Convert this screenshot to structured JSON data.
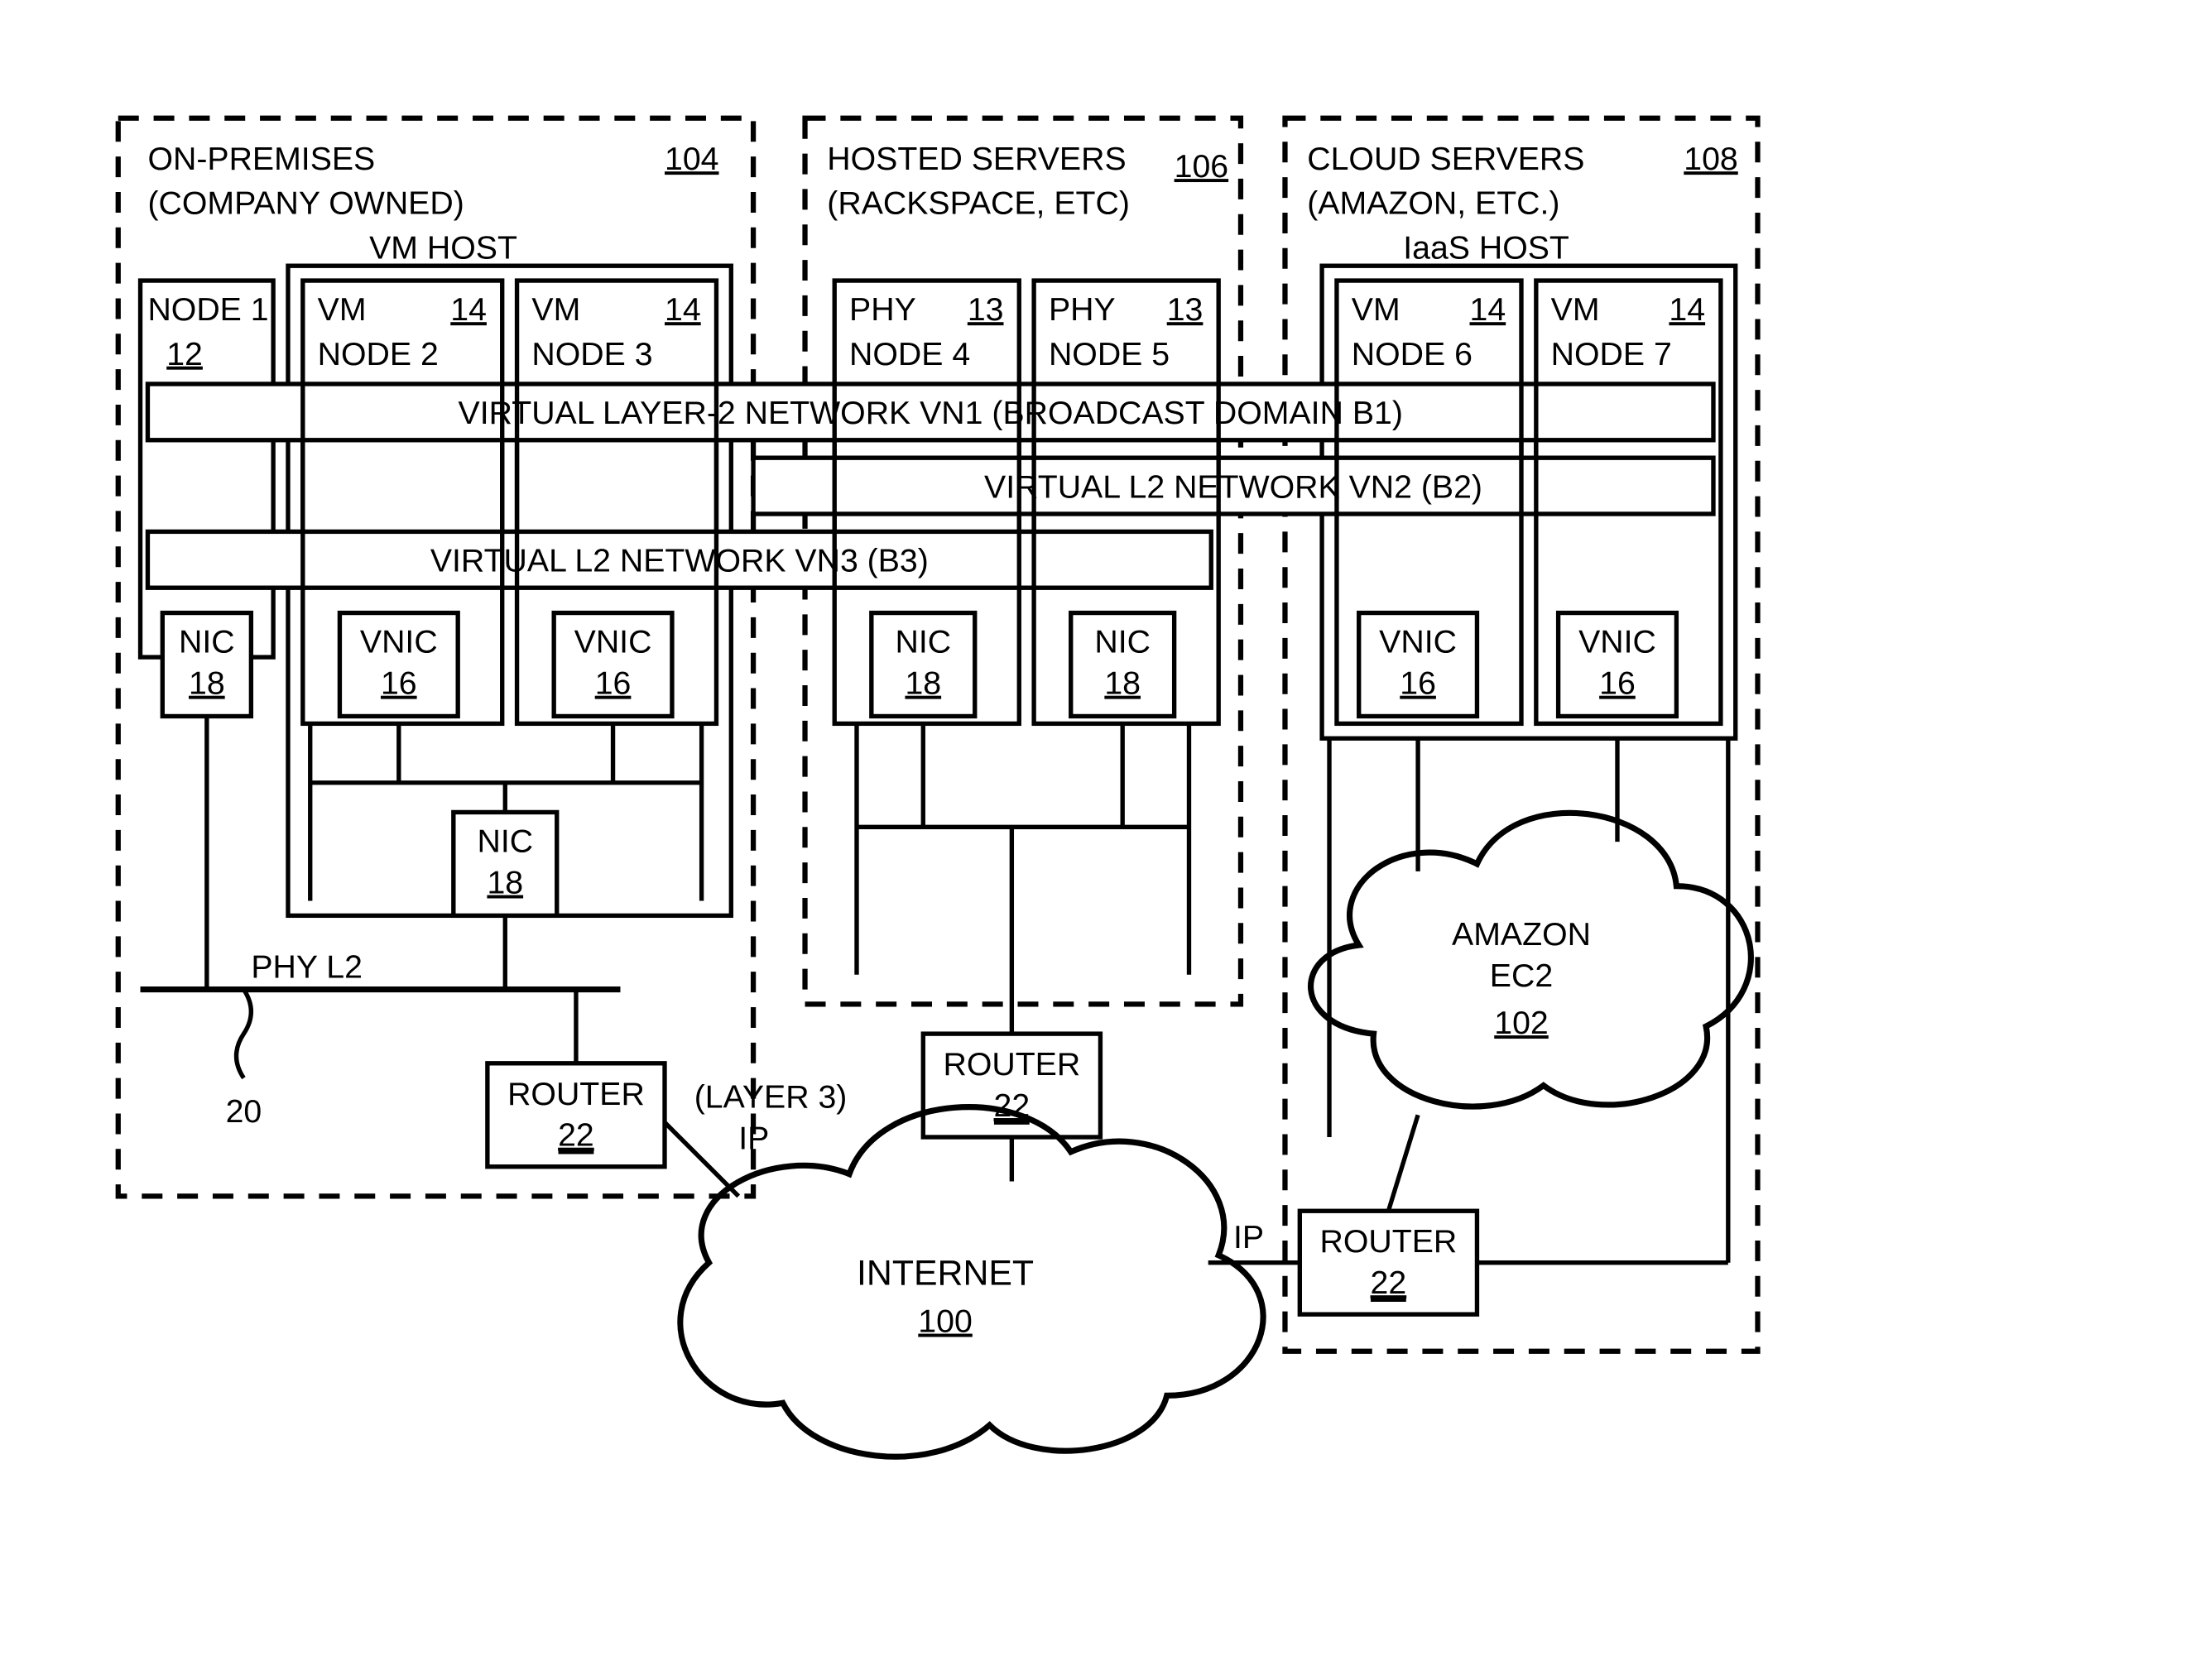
{
  "groups": {
    "onprem": {
      "title_line1": "ON-PREMISES",
      "title_line2": "(COMPANY OWNED)",
      "ref": "104"
    },
    "hosted": {
      "title_line1": "HOSTED SERVERS",
      "title_line2": "(RACKSPACE, ETC)",
      "ref": "106"
    },
    "cloud": {
      "title_line1": "CLOUD SERVERS",
      "title_line2": "(AMAZON, ETC.)",
      "ref": "108"
    }
  },
  "hosts": {
    "vmhost": "VM HOST",
    "iaashost": "IaaS HOST"
  },
  "nodes": {
    "n1": {
      "line1": "NODE 1",
      "ref": "12"
    },
    "n2": {
      "line1": "VM",
      "line2": "NODE 2",
      "ref": "14"
    },
    "n3": {
      "line1": "VM",
      "line2": "NODE 3",
      "ref": "14"
    },
    "n4": {
      "line1": "PHY",
      "line2": "NODE 4",
      "ref": "13"
    },
    "n5": {
      "line1": "PHY",
      "line2": "NODE 5",
      "ref": "13"
    },
    "n6": {
      "line1": "VM",
      "line2": "NODE 6",
      "ref": "14"
    },
    "n7": {
      "line1": "VM",
      "line2": "NODE 7",
      "ref": "14"
    }
  },
  "nets": {
    "vn1": "VIRTUAL LAYER-2 NETWORK  VN1  (BROADCAST DOMAIN B1)",
    "vn2": "VIRTUAL L2 NETWORK   VN2   (B2)",
    "vn3": "VIRTUAL L2 NETWORK   VN3   (B3)"
  },
  "nics": {
    "nic_label": "NIC",
    "vnic_label": "VNIC",
    "ref_nic": "18",
    "ref_vnic": "16"
  },
  "routers": {
    "label": "ROUTER",
    "ref": "22"
  },
  "clouds": {
    "internet": {
      "label": "INTERNET",
      "ref": "100"
    },
    "ec2": {
      "line1": "AMAZON",
      "line2": "EC2",
      "ref": "102"
    }
  },
  "misc": {
    "phy_l2": "PHY L2",
    "twenty": "20",
    "layer3": "(LAYER 3)",
    "ip": "IP"
  }
}
